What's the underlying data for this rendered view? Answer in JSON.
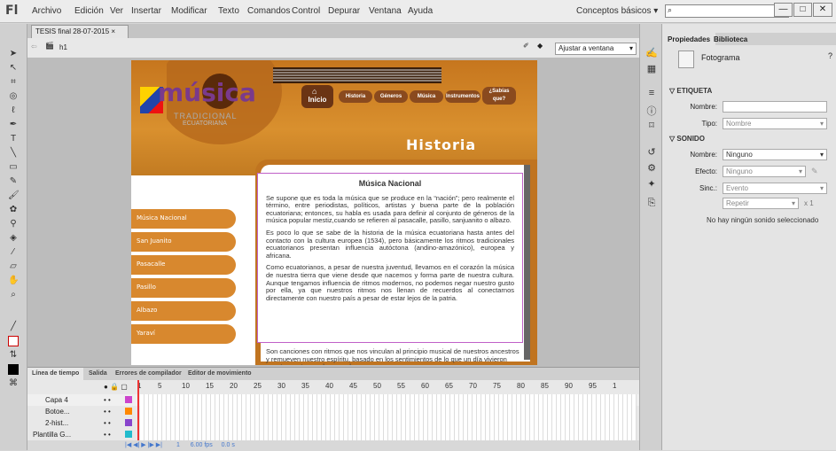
{
  "app": {
    "logo": "Fl"
  },
  "menu": [
    "Archivo",
    "Edición",
    "Ver",
    "Insertar",
    "Modificar",
    "Texto",
    "Comandos",
    "Control",
    "Depurar",
    "Ventana",
    "Ayuda"
  ],
  "workspace": "Conceptos básicos",
  "window_buttons": {
    "minimize": "—",
    "maximize": "□",
    "close": "✕"
  },
  "document": {
    "tab": "TESIS final 28-07-2015",
    "scene": "h1",
    "zoom": "Ajustar a ventana"
  },
  "stage": {
    "logo_main": "música",
    "logo_sub": "TRADICIONAL",
    "logo_sub2": "ECUATORIANA",
    "nav": {
      "inicio": "Inicio",
      "items": [
        "Historia",
        "Géneros",
        "Música",
        "Instrumentos",
        "¿Sabías que?"
      ]
    },
    "section_title": "Historia",
    "sidebar": [
      "Música Nacional",
      "San Juanito",
      "Pasacalle",
      "Pasillo",
      "Albazo",
      "Yaraví"
    ],
    "box_title": "Música Nacional",
    "paragraphs": [
      "Se supone que es toda la música que se produce en la “nación”; pero realmente el término, entre periodistas, políticos, artistas y buena parte de la población ecuatoriana; entonces, su habla es usada para definir al conjunto de géneros de la música popular mestiz,cuando se refieren al pasacalle, pasillo, sanjuanito o albazo.",
      "Es poco lo que se sabe de la historia de la música ecuatoriana hasta antes del contacto con la cultura europea (1534), pero básicamente los ritmos tradicionales ecuatorianos presentan influencia autóctona (andino-amazónico), europea y africana.",
      "Como ecuatorianos, a pesar de nuestra juventud, llevamos en el corazón la música de nuestra tierra que viene desde que nacemos y forma parte de nuestra cultura. Aunque tengamos influencia de ritmos modernos, no podemos negar nuestro gusto por ella, ya que nuestros ritmos nos llenan de recuerdos al conectarnos directamente con nuestro país a pesar de estar lejos de la patria."
    ],
    "overflow_text": "Son canciones con ritmos que nos vinculan al principio musical de nuestros ancestros y remueven nuestro espíritu, basado en los sentimientos de lo que un día vivieron nuestros antepasados con el"
  },
  "properties": {
    "tabs": [
      "Propiedades",
      "Biblioteca"
    ],
    "frame_label": "Fotograma",
    "etiqueta": {
      "header": "ETIQUETA",
      "nombre_label": "Nombre:",
      "nombre_value": "",
      "tipo_label": "Tipo:",
      "tipo_value": "Nombre"
    },
    "sonido": {
      "header": "SONIDO",
      "nombre_label": "Nombre:",
      "nombre_value": "Ninguno",
      "efecto_label": "Efecto:",
      "efecto_value": "Ninguno",
      "sinc_label": "Sinc.:",
      "sinc_value": "Evento",
      "repetir_value": "Repetir",
      "repeat_count": "x 1",
      "none_msg": "No hay ningún sonido seleccionado"
    }
  },
  "timeline": {
    "tabs": [
      "Línea de tiempo",
      "Salida",
      "Errores de compilador",
      "Editor de movimiento"
    ],
    "frame_numbers": [
      "1",
      "5",
      "10",
      "15",
      "20",
      "25",
      "30",
      "35",
      "40",
      "45",
      "50",
      "55",
      "60",
      "65",
      "70",
      "75",
      "80",
      "85",
      "90",
      "95",
      "1"
    ],
    "layers": [
      {
        "name": "Capa 4",
        "color": "#cc44cc"
      },
      {
        "name": "Botoe...",
        "color": "#ff8800"
      },
      {
        "name": "2-hist...",
        "color": "#8844cc"
      },
      {
        "name": "Plantilla G...",
        "color": "#22bbcc"
      }
    ],
    "footer": {
      "fps": "6.00 fps",
      "time": "0.0 s",
      "frame": "1"
    }
  }
}
